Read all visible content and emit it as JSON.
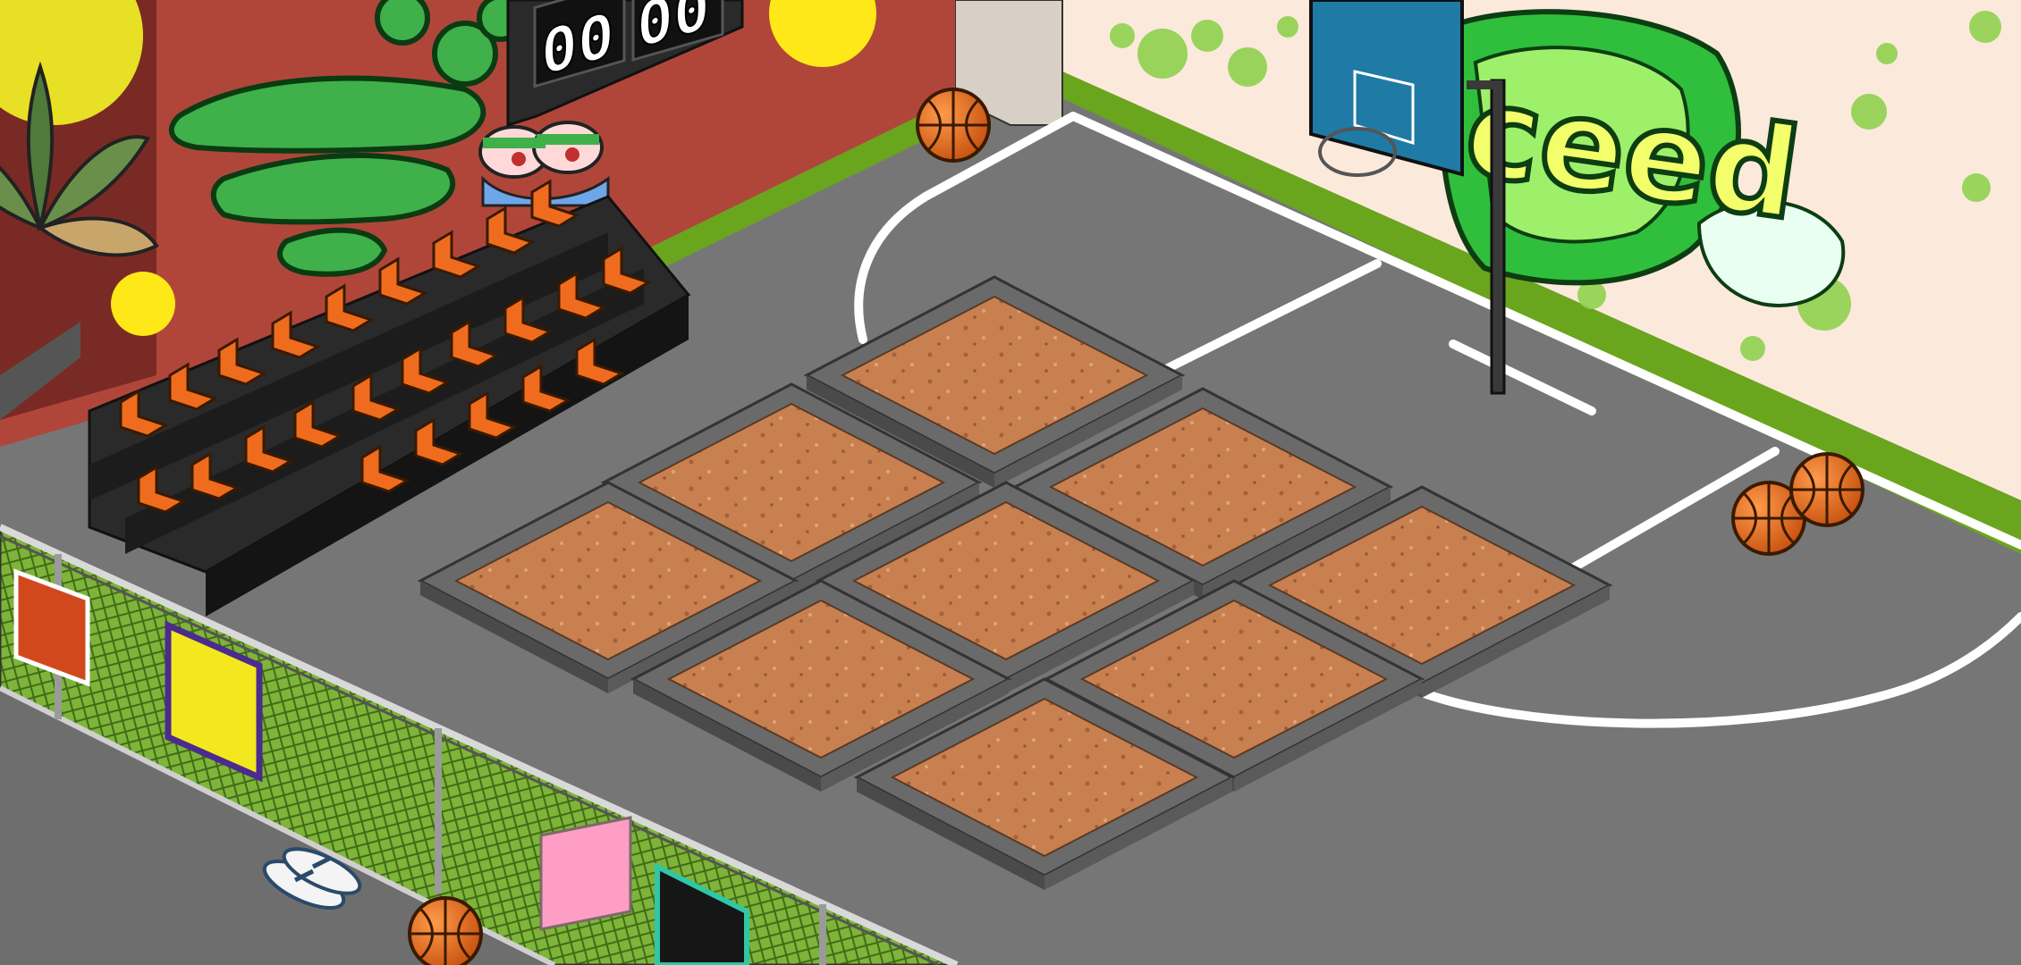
{
  "scene": {
    "type": "isometric game room",
    "theme": "street basketball court with graffiti walls and dirt garden plots"
  },
  "scoreboard": {
    "home_score": "00",
    "away_score": "00"
  },
  "graffiti": {
    "right_wall_tag": "ceed"
  },
  "colors": {
    "court": "#777777",
    "court_lines": "#ffffff",
    "left_wall": "#b0463a",
    "right_wall": "#fbe9dc",
    "wall_trim": "#6aa51e",
    "seats": "#ef6c1f",
    "bleacher": "#2a2a2a",
    "dirt": "#c97b4a",
    "brick": "#8a8a8a",
    "fence_mesh": "#6a9a2a",
    "basketball": "#e56a1b",
    "backboard": "#1f7aa6"
  },
  "objects": {
    "planters": 9,
    "basketballs": 4,
    "bleacher_seats": 24,
    "fence_panels": [
      "orange-panel",
      "yellow-panel",
      "pink-panel",
      "black-panel"
    ],
    "icons": [
      "basketball-icon",
      "hoop-icon",
      "flip-flops-icon",
      "scoreboard-icon",
      "weed-leaf-icon"
    ]
  }
}
